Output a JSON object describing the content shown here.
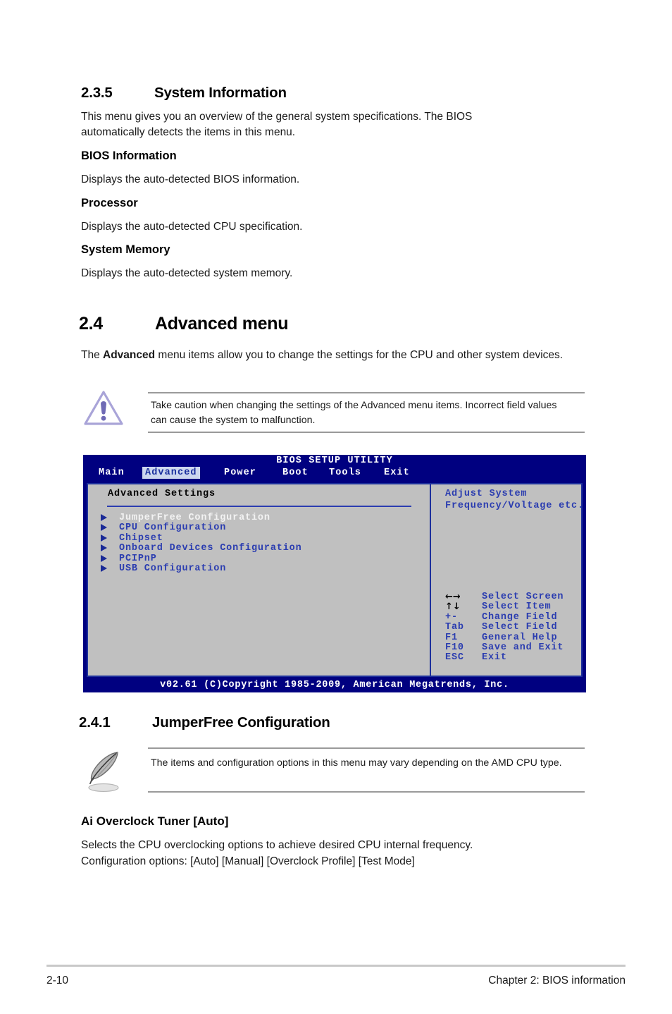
{
  "section_235": {
    "number": "2.3.5",
    "title": "System Information",
    "intro": "This menu gives you an overview of the general system specifications. The BIOS automatically detects the items in this menu.",
    "subsections": [
      {
        "heading": "BIOS Information",
        "text": "Displays the auto-detected BIOS information."
      },
      {
        "heading": "Processor",
        "text": "Displays the auto-detected CPU specification."
      },
      {
        "heading": "System Memory",
        "text": "Displays the auto-detected system memory."
      }
    ]
  },
  "section_24": {
    "number": "2.4",
    "title": "Advanced menu",
    "intro_before": "The ",
    "intro_bold": "Advanced",
    "intro_after": " menu items allow you to change the settings for the CPU and other system devices.",
    "caution": {
      "icon": "warning-triangle-icon",
      "text": "Take caution when changing the settings of the Advanced menu items. Incorrect field values can cause the system to malfunction."
    }
  },
  "bios": {
    "title": "BIOS SETUP UTILITY",
    "tabs": [
      {
        "label": "Main",
        "active": false
      },
      {
        "label": "Advanced",
        "active": true
      },
      {
        "label": "Power",
        "active": false
      },
      {
        "label": "Boot",
        "active": false
      },
      {
        "label": "Tools",
        "active": false
      },
      {
        "label": "Exit",
        "active": false
      }
    ],
    "panel_heading": "Advanced Settings",
    "menu_items": [
      {
        "label": "JumperFree Configuration",
        "selected": true
      },
      {
        "label": "CPU Configuration",
        "selected": false
      },
      {
        "label": "Chipset",
        "selected": false
      },
      {
        "label": "Onboard Devices Configuration",
        "selected": false
      },
      {
        "label": "PCIPnP",
        "selected": false
      },
      {
        "label": "USB Configuration",
        "selected": false
      }
    ],
    "help_text": "Adjust System\nFrequency/Voltage etc.",
    "keys": [
      {
        "key": "←→",
        "glyph": true,
        "desc": "Select Screen"
      },
      {
        "key": "↑↓",
        "glyph": true,
        "desc": "Select Item"
      },
      {
        "key": "+-",
        "glyph": false,
        "desc": "Change Field"
      },
      {
        "key": "Tab",
        "glyph": false,
        "desc": "Select Field"
      },
      {
        "key": "F1",
        "glyph": false,
        "desc": "General Help"
      },
      {
        "key": "F10",
        "glyph": false,
        "desc": "Save and Exit"
      },
      {
        "key": "ESC",
        "glyph": false,
        "desc": "Exit"
      }
    ],
    "footer": "v02.61 (C)Copyright 1985-2009, American Megatrends, Inc.",
    "colors": {
      "background": "#000080",
      "panel": "#c0c0c0",
      "border": "#1d2f9c",
      "text_blue": "#2b3db0",
      "tab_active_bg": "#ccd6ee",
      "tab_active_text": "#1a2f9e",
      "selected_item": "#f2f2f2"
    }
  },
  "section_241": {
    "number": "2.4.1",
    "title": "JumperFree Configuration",
    "note": {
      "icon": "quill-pen-icon",
      "text": "The items and configuration options in this menu may vary depending on the AMD CPU type."
    },
    "item": {
      "heading": "Ai Overclock Tuner [Auto]",
      "line1": "Selects the CPU overclocking options to achieve desired CPU internal frequency.",
      "line2": "Configuration options: [Auto] [Manual] [Overclock Profile] [Test Mode]"
    }
  },
  "page_footer": {
    "page_number": "2-10",
    "chapter": "Chapter 2: BIOS information"
  }
}
